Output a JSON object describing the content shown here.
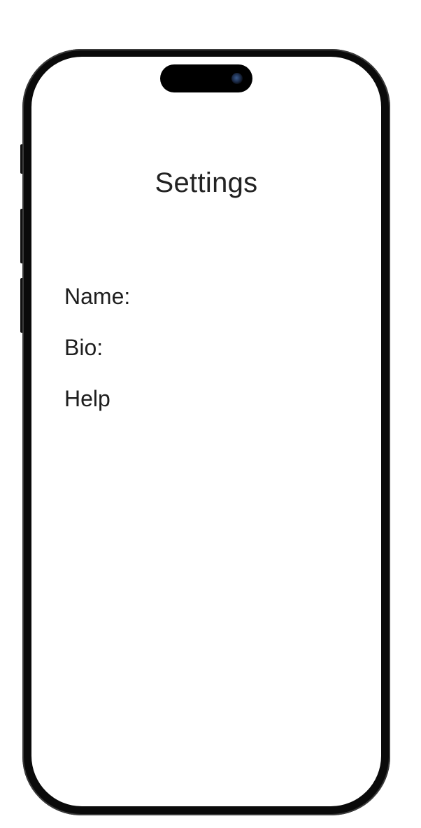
{
  "screen": {
    "title": "Settings"
  },
  "settings": {
    "items": [
      {
        "label": "Name:"
      },
      {
        "label": "Bio:"
      },
      {
        "label": "Help"
      }
    ]
  },
  "colors": {
    "frame": "#0a0a0a",
    "screen_background": "#ffffff",
    "text": "#222222"
  }
}
